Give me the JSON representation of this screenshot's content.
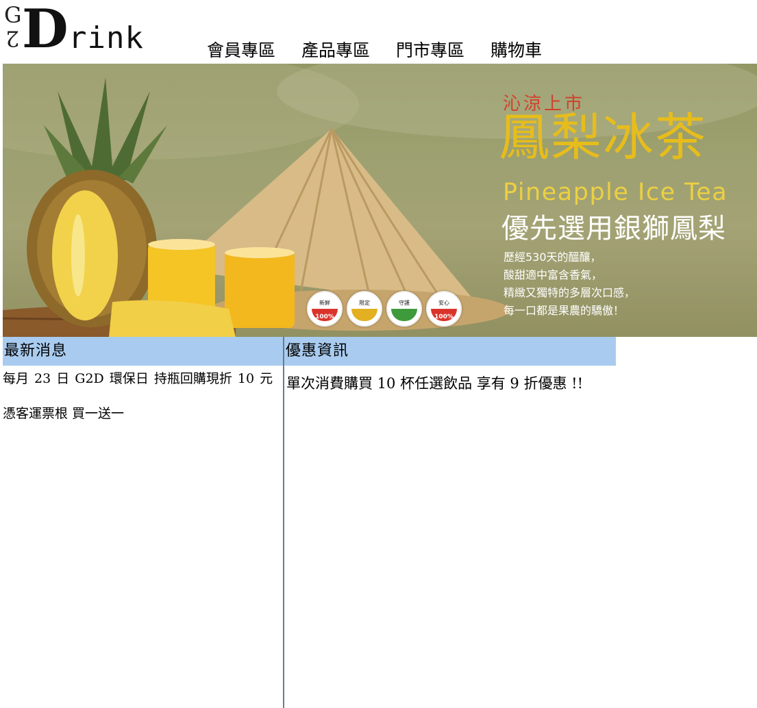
{
  "brand": {
    "letter_g": "G",
    "digit_2": "2",
    "letter_d": "D",
    "word_rest": "rink"
  },
  "nav": {
    "items": [
      {
        "label": "會員專區"
      },
      {
        "label": "產品專區"
      },
      {
        "label": "門市專區"
      },
      {
        "label": "購物車"
      }
    ]
  },
  "banner": {
    "subtitle": "沁涼上市",
    "title": "鳳梨冰茶",
    "title_en": "Pineapple Ice Tea",
    "tagline": "優先選用銀獅鳳梨",
    "lines": [
      "歷經530天的醞釀，",
      "酸甜適中富含香氣，",
      "精緻又獨特的多層次口感，",
      "每一口都是果農的驕傲！"
    ],
    "badges": [
      {
        "label": "新鮮",
        "percent": "100%",
        "color": "#d9342b"
      },
      {
        "label": "限定",
        "percent": "",
        "color": "#e2b021"
      },
      {
        "label": "守護",
        "percent": "",
        "color": "#3f9a3c"
      },
      {
        "label": "安心",
        "percent": "100%",
        "color": "#d9342b"
      }
    ]
  },
  "news": {
    "heading": "最新消息",
    "items": [
      "每月  23 日 G2D 環保日    持瓶回購現折 10 元",
      "憑客運票根  買一送一"
    ]
  },
  "promo": {
    "heading": "優惠資訊",
    "text": "單次消費購買 10 杯任選飲品  享有 9 折優惠  !!"
  },
  "colors": {
    "panel_header": "#a9cbef",
    "title_yellow": "#e7bd1c",
    "subtitle_red": "#d2402a",
    "divider": "#6b7a8f"
  }
}
